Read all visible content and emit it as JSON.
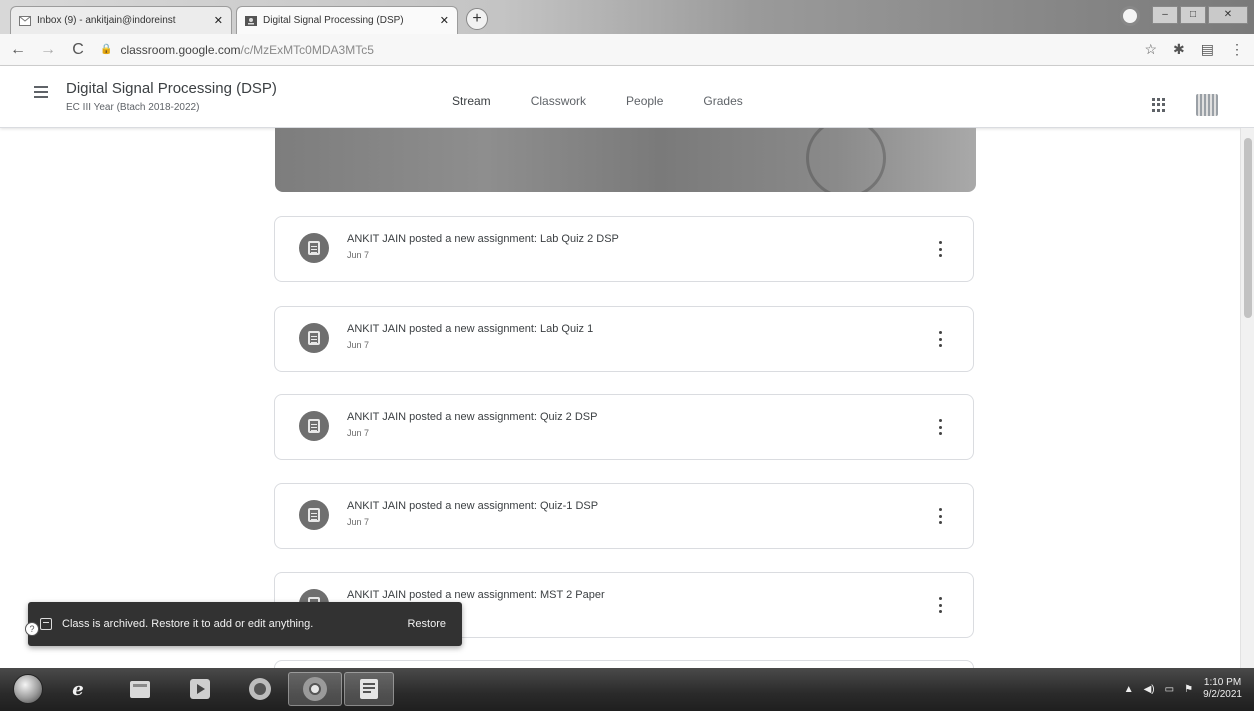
{
  "browser": {
    "tabs": [
      {
        "title": "Inbox (9) - ankitjain@indoreinst",
        "active": false,
        "icon": "gmail-icon"
      },
      {
        "title": "Digital Signal Processing (DSP)",
        "active": true,
        "icon": "classroom-icon"
      }
    ],
    "new_tab_label": "+",
    "url_host": "classroom.google.com",
    "url_path": "/c/MzExMTc0MDA3MTc5"
  },
  "classroom": {
    "class_title": "Digital Signal Processing (DSP)",
    "class_subtitle": "EC III Year (Btach 2018-2022)",
    "nav_tabs": [
      {
        "label": "Stream",
        "active": true
      },
      {
        "label": "Classwork",
        "active": false
      },
      {
        "label": "People",
        "active": false
      },
      {
        "label": "Grades",
        "active": false
      }
    ]
  },
  "posts": [
    {
      "title": "ANKIT JAIN posted a new assignment: Lab Quiz 2 DSP",
      "date": "Jun 7"
    },
    {
      "title": "ANKIT JAIN posted a new assignment: Lab Quiz 1",
      "date": "Jun 7"
    },
    {
      "title": "ANKIT JAIN posted a new assignment: Quiz 2 DSP",
      "date": "Jun 7"
    },
    {
      "title": "ANKIT JAIN posted a new assignment: Quiz-1 DSP",
      "date": "Jun 7"
    },
    {
      "title": "ANKIT JAIN posted a new assignment: MST 2 Paper",
      "date": ""
    }
  ],
  "snackbar": {
    "message": "Class is archived. Restore it to add or edit anything.",
    "action": "Restore"
  },
  "taskbar": {
    "apps": [
      "ie-icon",
      "file-explorer-icon",
      "media-player-icon",
      "firefox-icon",
      "chrome-icon",
      "word-icon"
    ],
    "time": "1:10 PM",
    "date": "9/2/2021"
  }
}
